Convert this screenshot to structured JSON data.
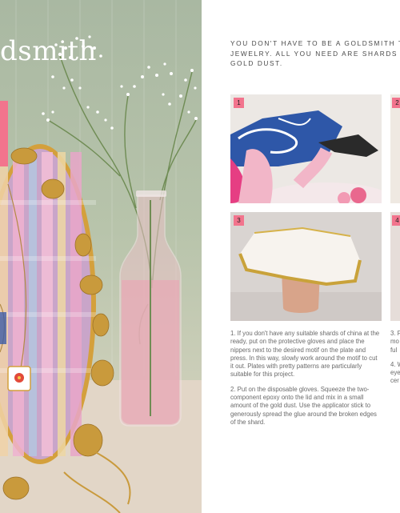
{
  "left_page": {
    "title_fragment": "dsmith"
  },
  "intro": {
    "line1": "YOU DON'T HAVE TO BE A GOLDSMITH TO DE",
    "line2": "JEWELRY. ALL YOU NEED ARE SHARDS OF CHI",
    "line3": "GOLD DUST."
  },
  "badges": [
    "1",
    "2",
    "3",
    "4"
  ],
  "steps_main": [
    "1. If you don't have any suitable shards of china at the ready, put on the protective gloves and place the nippers next to the desired motif on the plate and press. In this way, slowly work around the motif to cut it out. Plates with pretty patterns are particularly suitable for this project.",
    "2. Put on the disposable gloves. Squeeze the two-component epoxy onto the lid and mix in a small amount of the gold dust. Use the applicator stick to generously spread the glue around the broken edges of the shard."
  ],
  "steps_side": {
    "a1": "3. P",
    "a2": "mo",
    "a3": "ful",
    "b1": "4. W",
    "b2": "eye",
    "b3": "cer"
  },
  "colors": {
    "accent": "#f2748d",
    "text": "#6a6a6a"
  }
}
